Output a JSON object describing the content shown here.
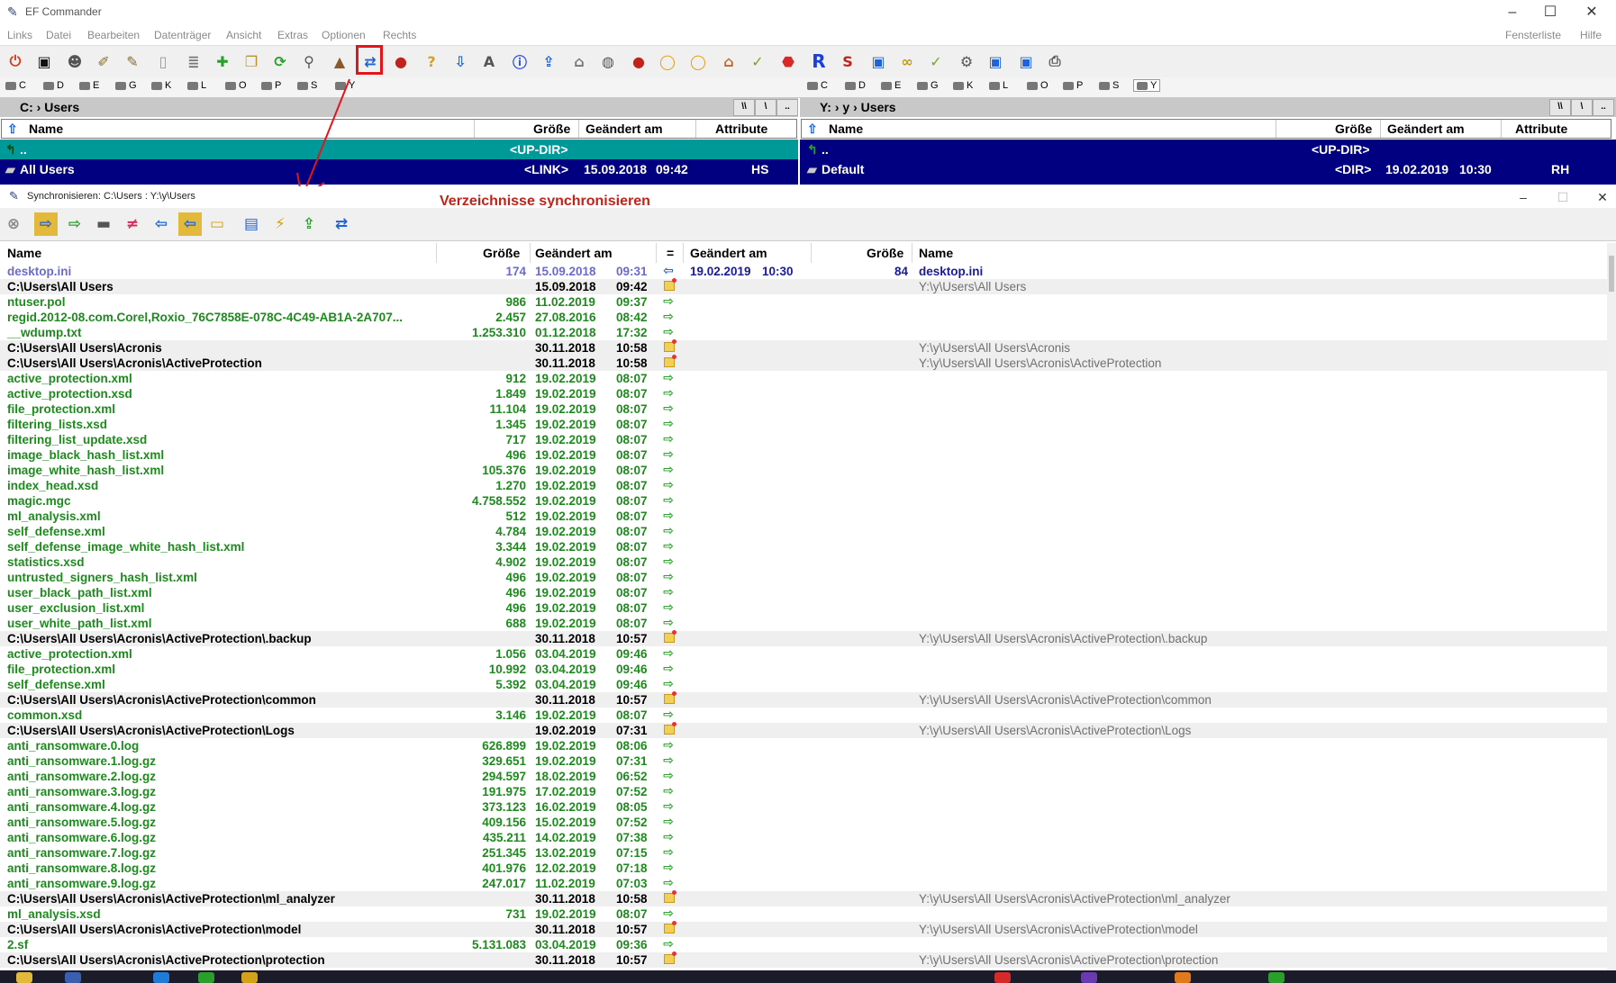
{
  "app": {
    "title": "EF Commander"
  },
  "menu": {
    "left": [
      "Links",
      "Datei",
      "Bearbeiten",
      "Datenträger",
      "Ansicht",
      "Extras",
      "Optionen",
      "Rechts"
    ],
    "right": [
      "Fensterliste",
      "Hilfe"
    ]
  },
  "drives_left": [
    "C",
    "D",
    "E",
    "G",
    "K",
    "L",
    "O",
    "P",
    "S",
    "Y"
  ],
  "drives_right": [
    "C",
    "D",
    "E",
    "G",
    "K",
    "L",
    "O",
    "P",
    "S",
    "Y"
  ],
  "left_panel": {
    "path_drive": "C:",
    "path_folder": "Users",
    "columns": {
      "name": "Name",
      "size": "Größe",
      "modified": "Geändert am",
      "attr": "Attribute"
    },
    "rows": [
      {
        "name": "..",
        "size": "<UP-DIR>",
        "date": "",
        "time": "",
        "attr": ""
      },
      {
        "name": "All Users",
        "size": "<LINK>",
        "date": "15.09.2018",
        "time": "09:42",
        "attr": "HS"
      }
    ]
  },
  "right_panel": {
    "path_drive": "Y:",
    "path_sub": "y",
    "path_folder": "Users",
    "columns": {
      "name": "Name",
      "size": "Größe",
      "modified": "Geändert am",
      "attr": "Attribute"
    },
    "rows": [
      {
        "name": "..",
        "size": "<UP-DIR>",
        "date": "",
        "time": "",
        "attr": ""
      },
      {
        "name": "Default",
        "size": "<DIR>",
        "date": "19.02.2019",
        "time": "10:30",
        "attr": "RH"
      }
    ]
  },
  "sync": {
    "title": "Synchronisieren: C:\\Users : Y:\\y\\Users",
    "annotation": "Verzeichnisse synchronisieren",
    "columns": {
      "name": "Name",
      "size": "Größe",
      "modified": "Geändert am",
      "eq": "=",
      "r_modified": "Geändert am",
      "r_size": "Größe",
      "r_name": "Name"
    },
    "rows": [
      {
        "type": "old",
        "name": "desktop.ini",
        "size": "174",
        "date": "15.09.2018",
        "time": "09:31",
        "action": "left",
        "r_date": "19.02.2019",
        "r_time": "10:30",
        "r_size": "84",
        "r_name": "desktop.ini"
      },
      {
        "type": "dir",
        "name": "C:\\Users\\All Users",
        "size": "",
        "date": "15.09.2018",
        "time": "09:42",
        "action": "folder",
        "r_name": "Y:\\y\\Users\\All Users"
      },
      {
        "type": "file",
        "name": "ntuser.pol",
        "size": "986",
        "date": "11.02.2019",
        "time": "09:37",
        "action": "right"
      },
      {
        "type": "file",
        "name": "regid.2012-08.com.Corel,Roxio_76C7858E-078C-4C49-AB1A-2A707...",
        "size": "2.457",
        "date": "27.08.2016",
        "time": "08:42",
        "action": "right"
      },
      {
        "type": "file",
        "name": "__wdump.txt",
        "size": "1.253.310",
        "date": "01.12.2018",
        "time": "17:32",
        "action": "right"
      },
      {
        "type": "dir",
        "name": "C:\\Users\\All Users\\Acronis",
        "size": "",
        "date": "30.11.2018",
        "time": "10:58",
        "action": "folder",
        "r_name": "Y:\\y\\Users\\All Users\\Acronis"
      },
      {
        "type": "dir",
        "name": "C:\\Users\\All Users\\Acronis\\ActiveProtection",
        "size": "",
        "date": "30.11.2018",
        "time": "10:58",
        "action": "folder",
        "r_name": "Y:\\y\\Users\\All Users\\Acronis\\ActiveProtection"
      },
      {
        "type": "file",
        "name": "active_protection.xml",
        "size": "912",
        "date": "19.02.2019",
        "time": "08:07",
        "action": "right"
      },
      {
        "type": "file",
        "name": "active_protection.xsd",
        "size": "1.849",
        "date": "19.02.2019",
        "time": "08:07",
        "action": "right"
      },
      {
        "type": "file",
        "name": "file_protection.xml",
        "size": "11.104",
        "date": "19.02.2019",
        "time": "08:07",
        "action": "right"
      },
      {
        "type": "file",
        "name": "filtering_lists.xsd",
        "size": "1.345",
        "date": "19.02.2019",
        "time": "08:07",
        "action": "right"
      },
      {
        "type": "file",
        "name": "filtering_list_update.xsd",
        "size": "717",
        "date": "19.02.2019",
        "time": "08:07",
        "action": "right"
      },
      {
        "type": "file",
        "name": "image_black_hash_list.xml",
        "size": "496",
        "date": "19.02.2019",
        "time": "08:07",
        "action": "right"
      },
      {
        "type": "file",
        "name": "image_white_hash_list.xml",
        "size": "105.376",
        "date": "19.02.2019",
        "time": "08:07",
        "action": "right"
      },
      {
        "type": "file",
        "name": "index_head.xsd",
        "size": "1.270",
        "date": "19.02.2019",
        "time": "08:07",
        "action": "right"
      },
      {
        "type": "file",
        "name": "magic.mgc",
        "size": "4.758.552",
        "date": "19.02.2019",
        "time": "08:07",
        "action": "right"
      },
      {
        "type": "file",
        "name": "ml_analysis.xml",
        "size": "512",
        "date": "19.02.2019",
        "time": "08:07",
        "action": "right"
      },
      {
        "type": "file",
        "name": "self_defense.xml",
        "size": "4.784",
        "date": "19.02.2019",
        "time": "08:07",
        "action": "right"
      },
      {
        "type": "file",
        "name": "self_defense_image_white_hash_list.xml",
        "size": "3.344",
        "date": "19.02.2019",
        "time": "08:07",
        "action": "right"
      },
      {
        "type": "file",
        "name": "statistics.xsd",
        "size": "4.902",
        "date": "19.02.2019",
        "time": "08:07",
        "action": "right"
      },
      {
        "type": "file",
        "name": "untrusted_signers_hash_list.xml",
        "size": "496",
        "date": "19.02.2019",
        "time": "08:07",
        "action": "right"
      },
      {
        "type": "file",
        "name": "user_black_path_list.xml",
        "size": "496",
        "date": "19.02.2019",
        "time": "08:07",
        "action": "right"
      },
      {
        "type": "file",
        "name": "user_exclusion_list.xml",
        "size": "496",
        "date": "19.02.2019",
        "time": "08:07",
        "action": "right"
      },
      {
        "type": "file",
        "name": "user_white_path_list.xml",
        "size": "688",
        "date": "19.02.2019",
        "time": "08:07",
        "action": "right"
      },
      {
        "type": "dir",
        "name": "C:\\Users\\All Users\\Acronis\\ActiveProtection\\.backup",
        "size": "",
        "date": "30.11.2018",
        "time": "10:57",
        "action": "folder",
        "r_name": "Y:\\y\\Users\\All Users\\Acronis\\ActiveProtection\\.backup"
      },
      {
        "type": "file",
        "name": "active_protection.xml",
        "size": "1.056",
        "date": "03.04.2019",
        "time": "09:46",
        "action": "right"
      },
      {
        "type": "file",
        "name": "file_protection.xml",
        "size": "10.992",
        "date": "03.04.2019",
        "time": "09:46",
        "action": "right"
      },
      {
        "type": "file",
        "name": "self_defense.xml",
        "size": "5.392",
        "date": "03.04.2019",
        "time": "09:46",
        "action": "right"
      },
      {
        "type": "dir",
        "name": "C:\\Users\\All Users\\Acronis\\ActiveProtection\\common",
        "size": "",
        "date": "30.11.2018",
        "time": "10:57",
        "action": "folder",
        "r_name": "Y:\\y\\Users\\All Users\\Acronis\\ActiveProtection\\common"
      },
      {
        "type": "file",
        "name": "common.xsd",
        "size": "3.146",
        "date": "19.02.2019",
        "time": "08:07",
        "action": "right"
      },
      {
        "type": "dir",
        "name": "C:\\Users\\All Users\\Acronis\\ActiveProtection\\Logs",
        "size": "",
        "date": "19.02.2019",
        "time": "07:31",
        "action": "folder",
        "r_name": "Y:\\y\\Users\\All Users\\Acronis\\ActiveProtection\\Logs"
      },
      {
        "type": "file",
        "name": "anti_ransomware.0.log",
        "size": "626.899",
        "date": "19.02.2019",
        "time": "08:06",
        "action": "right"
      },
      {
        "type": "file",
        "name": "anti_ransomware.1.log.gz",
        "size": "329.651",
        "date": "19.02.2019",
        "time": "07:31",
        "action": "right"
      },
      {
        "type": "file",
        "name": "anti_ransomware.2.log.gz",
        "size": "294.597",
        "date": "18.02.2019",
        "time": "06:52",
        "action": "right"
      },
      {
        "type": "file",
        "name": "anti_ransomware.3.log.gz",
        "size": "191.975",
        "date": "17.02.2019",
        "time": "07:52",
        "action": "right"
      },
      {
        "type": "file",
        "name": "anti_ransomware.4.log.gz",
        "size": "373.123",
        "date": "16.02.2019",
        "time": "08:05",
        "action": "right"
      },
      {
        "type": "file",
        "name": "anti_ransomware.5.log.gz",
        "size": "409.156",
        "date": "15.02.2019",
        "time": "07:52",
        "action": "right"
      },
      {
        "type": "file",
        "name": "anti_ransomware.6.log.gz",
        "size": "435.211",
        "date": "14.02.2019",
        "time": "07:38",
        "action": "right"
      },
      {
        "type": "file",
        "name": "anti_ransomware.7.log.gz",
        "size": "251.345",
        "date": "13.02.2019",
        "time": "07:15",
        "action": "right"
      },
      {
        "type": "file",
        "name": "anti_ransomware.8.log.gz",
        "size": "401.976",
        "date": "12.02.2019",
        "time": "07:18",
        "action": "right"
      },
      {
        "type": "file",
        "name": "anti_ransomware.9.log.gz",
        "size": "247.017",
        "date": "11.02.2019",
        "time": "07:03",
        "action": "right"
      },
      {
        "type": "dir",
        "name": "C:\\Users\\All Users\\Acronis\\ActiveProtection\\ml_analyzer",
        "size": "",
        "date": "30.11.2018",
        "time": "10:58",
        "action": "folder",
        "r_name": "Y:\\y\\Users\\All Users\\Acronis\\ActiveProtection\\ml_analyzer"
      },
      {
        "type": "file",
        "name": "ml_analysis.xsd",
        "size": "731",
        "date": "19.02.2019",
        "time": "08:07",
        "action": "right"
      },
      {
        "type": "dir",
        "name": "C:\\Users\\All Users\\Acronis\\ActiveProtection\\model",
        "size": "",
        "date": "30.11.2018",
        "time": "10:57",
        "action": "folder",
        "r_name": "Y:\\y\\Users\\All Users\\Acronis\\ActiveProtection\\model"
      },
      {
        "type": "file",
        "name": "2.sf",
        "size": "5.131.083",
        "date": "03.04.2019",
        "time": "09:36",
        "action": "right"
      },
      {
        "type": "dir",
        "name": "C:\\Users\\All Users\\Acronis\\ActiveProtection\\protection",
        "size": "",
        "date": "30.11.2018",
        "time": "10:57",
        "action": "folder",
        "r_name": "Y:\\y\\Users\\All Users\\Acronis\\ActiveProtection\\protection"
      }
    ]
  },
  "colors": {
    "selected_row": "#00999a",
    "panel_bg": "#000080",
    "file_green": "#1e8a1e",
    "annotation_red": "#c0231a"
  }
}
